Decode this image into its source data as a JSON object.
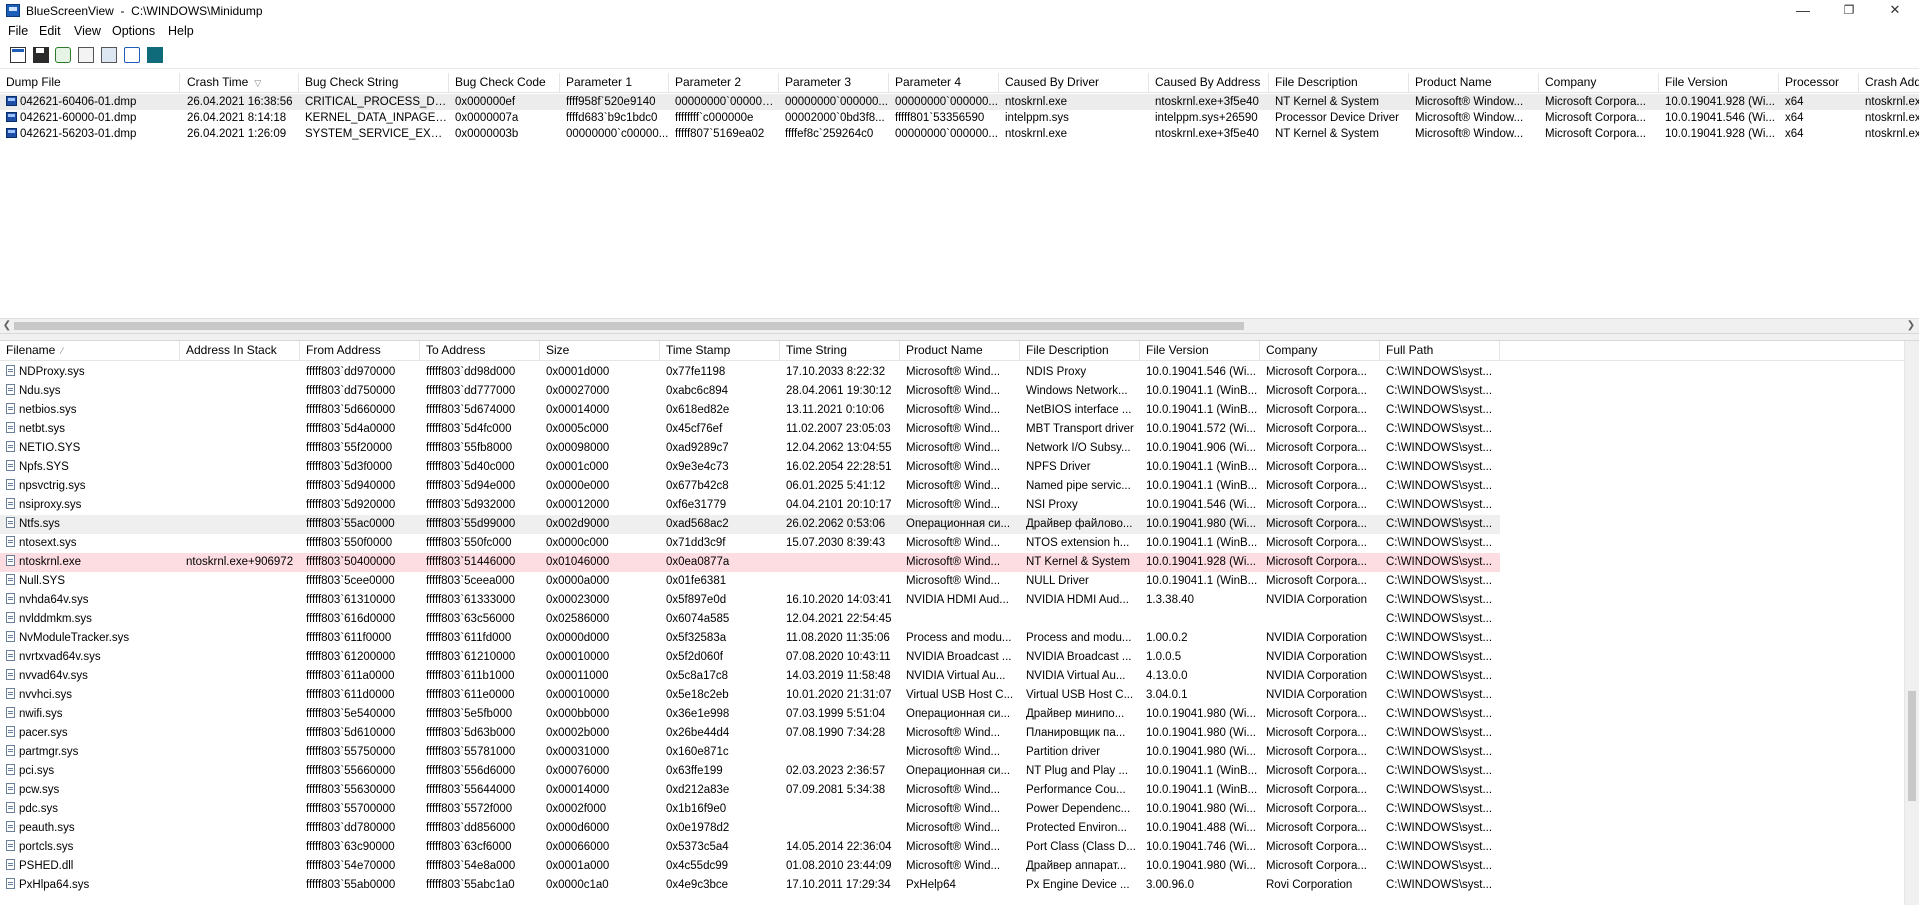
{
  "window": {
    "title": "BlueScreenView  -  C:\\WINDOWS\\Minidump",
    "minimize": "—",
    "maximize": "❐",
    "close": "✕"
  },
  "menu": [
    "File",
    "Edit",
    "View",
    "Options",
    "Help"
  ],
  "toolbar": [
    "properties-icon",
    "save-icon",
    "refresh-icon",
    "copy-icon",
    "html-report-icon",
    "find-icon",
    "exit-icon"
  ],
  "dumps": {
    "columns": [
      "Dump File",
      "Crash Time",
      "Bug Check String",
      "Bug Check Code",
      "Parameter 1",
      "Parameter 2",
      "Parameter 3",
      "Parameter 4",
      "Caused By Driver",
      "Caused By Address",
      "File Description",
      "Product Name",
      "Company",
      "File Version",
      "Processor",
      "Crash Address"
    ],
    "sort_indicator": "▽",
    "rows": [
      [
        "042621-60406-01.dmp",
        "26.04.2021 16:38:56",
        "CRITICAL_PROCESS_DIED",
        "0x000000ef",
        "ffff958f`520e9140",
        "00000000`0000000...",
        "00000000`000000...",
        "00000000`000000...",
        "ntoskrnl.exe",
        "ntoskrnl.exe+3f5e40",
        "NT Kernel & System",
        "Microsoft® Window...",
        "Microsoft Corpora...",
        "10.0.19041.928 (Wi...",
        "x64",
        "ntoskrnl.exe"
      ],
      [
        "042621-60000-01.dmp",
        "26.04.2021 8:14:18",
        "KERNEL_DATA_INPAGE_...",
        "0x0000007a",
        "ffffd683`b9c1bdc0",
        "ffffffff`c000000e",
        "00002000`0bd3f8...",
        "fffff801`53356590",
        "intelppm.sys",
        "intelppm.sys+26590",
        "Processor Device Driver",
        "Microsoft® Window...",
        "Microsoft Corpora...",
        "10.0.19041.546 (Wi...",
        "x64",
        "ntoskrnl.exe"
      ],
      [
        "042621-56203-01.dmp",
        "26.04.2021 1:26:09",
        "SYSTEM_SERVICE_EXCEP...",
        "0x0000003b",
        "00000000`c00000...",
        "fffff807`5169ea02",
        "ffffef8c`259264c0",
        "00000000`000000...",
        "ntoskrnl.exe",
        "ntoskrnl.exe+3f5e40",
        "NT Kernel & System",
        "Microsoft® Window...",
        "Microsoft Corpora...",
        "10.0.19041.928 (Wi...",
        "x64",
        "ntoskrnl.exe"
      ]
    ]
  },
  "modules": {
    "columns": [
      "Filename",
      "Address In Stack",
      "From Address",
      "To Address",
      "Size",
      "Time Stamp",
      "Time String",
      "Product Name",
      "File Description",
      "File Version",
      "Company",
      "Full Path"
    ],
    "sort_indicator": "⁄",
    "rows": [
      [
        "NDProxy.sys",
        "",
        "fffff803`dd970000",
        "fffff803`dd98d000",
        "0x0001d000",
        "0x77fe1198",
        "17.10.2033 8:22:32",
        "Microsoft® Wind...",
        "NDIS Proxy",
        "10.0.19041.546 (Wi...",
        "Microsoft Corpora...",
        "C:\\WINDOWS\\syst..."
      ],
      [
        "Ndu.sys",
        "",
        "fffff803`dd750000",
        "fffff803`dd777000",
        "0x00027000",
        "0xabc6c894",
        "28.04.2061 19:30:12",
        "Microsoft® Wind...",
        "Windows Network...",
        "10.0.19041.1 (WinB...",
        "Microsoft Corpora...",
        "C:\\WINDOWS\\syst..."
      ],
      [
        "netbios.sys",
        "",
        "fffff803`5d660000",
        "fffff803`5d674000",
        "0x00014000",
        "0x618ed82e",
        "13.11.2021 0:10:06",
        "Microsoft® Wind...",
        "NetBIOS interface ...",
        "10.0.19041.1 (WinB...",
        "Microsoft Corpora...",
        "C:\\WINDOWS\\syst..."
      ],
      [
        "netbt.sys",
        "",
        "fffff803`5d4a0000",
        "fffff803`5d4fc000",
        "0x0005c000",
        "0x45cf76ef",
        "11.02.2007 23:05:03",
        "Microsoft® Wind...",
        "MBT Transport driver",
        "10.0.19041.572 (Wi...",
        "Microsoft Corpora...",
        "C:\\WINDOWS\\syst..."
      ],
      [
        "NETIO.SYS",
        "",
        "fffff803`55f20000",
        "fffff803`55fb8000",
        "0x00098000",
        "0xad9289c7",
        "12.04.2062 13:04:55",
        "Microsoft® Wind...",
        "Network I/O Subsy...",
        "10.0.19041.906 (Wi...",
        "Microsoft Corpora...",
        "C:\\WINDOWS\\syst..."
      ],
      [
        "Npfs.SYS",
        "",
        "fffff803`5d3f0000",
        "fffff803`5d40c000",
        "0x0001c000",
        "0x9e3e4c73",
        "16.02.2054 22:28:51",
        "Microsoft® Wind...",
        "NPFS Driver",
        "10.0.19041.1 (WinB...",
        "Microsoft Corpora...",
        "C:\\WINDOWS\\syst..."
      ],
      [
        "npsvctrig.sys",
        "",
        "fffff803`5d940000",
        "fffff803`5d94e000",
        "0x0000e000",
        "0x677b42c8",
        "06.01.2025 5:41:12",
        "Microsoft® Wind...",
        "Named pipe servic...",
        "10.0.19041.1 (WinB...",
        "Microsoft Corpora...",
        "C:\\WINDOWS\\syst..."
      ],
      [
        "nsiproxy.sys",
        "",
        "fffff803`5d920000",
        "fffff803`5d932000",
        "0x00012000",
        "0xf6e31779",
        "04.04.2101 20:10:17",
        "Microsoft® Wind...",
        "NSI Proxy",
        "10.0.19041.546 (Wi...",
        "Microsoft Corpora...",
        "C:\\WINDOWS\\syst..."
      ],
      [
        "Ntfs.sys",
        "",
        "fffff803`55ac0000",
        "fffff803`55d99000",
        "0x002d9000",
        "0xad568ac2",
        "26.02.2062 0:53:06",
        "Операционная си...",
        "Драйвер файлово...",
        "10.0.19041.980 (Wi...",
        "Microsoft Corpora...",
        "C:\\WINDOWS\\syst..."
      ],
      [
        "ntosext.sys",
        "",
        "fffff803`550f0000",
        "fffff803`550fc000",
        "0x0000c000",
        "0x71dd3c9f",
        "15.07.2030 8:39:43",
        "Microsoft® Wind...",
        "NTOS extension h...",
        "10.0.19041.1 (WinB...",
        "Microsoft Corpora...",
        "C:\\WINDOWS\\syst..."
      ],
      [
        "ntoskrnl.exe",
        "ntoskrnl.exe+906972",
        "fffff803`50400000",
        "fffff803`51446000",
        "0x01046000",
        "0x0ea0877a",
        "",
        "Microsoft® Wind...",
        "NT Kernel & System",
        "10.0.19041.928 (Wi...",
        "Microsoft Corpora...",
        "C:\\WINDOWS\\syst..."
      ],
      [
        "Null.SYS",
        "",
        "fffff803`5cee0000",
        "fffff803`5ceea000",
        "0x0000a000",
        "0x01fe6381",
        "",
        "Microsoft® Wind...",
        "NULL Driver",
        "10.0.19041.1 (WinB...",
        "Microsoft Corpora...",
        "C:\\WINDOWS\\syst..."
      ],
      [
        "nvhda64v.sys",
        "",
        "fffff803`61310000",
        "fffff803`61333000",
        "0x00023000",
        "0x5f897e0d",
        "16.10.2020 14:03:41",
        "NVIDIA HDMI Aud...",
        "NVIDIA HDMI Aud...",
        "1.3.38.40",
        "NVIDIA Corporation",
        "C:\\WINDOWS\\syst..."
      ],
      [
        "nvlddmkm.sys",
        "",
        "fffff803`616d0000",
        "fffff803`63c56000",
        "0x02586000",
        "0x6074a585",
        "12.04.2021 22:54:45",
        "",
        "",
        "",
        "",
        "C:\\WINDOWS\\syst..."
      ],
      [
        "NvModuleTracker.sys",
        "",
        "fffff803`611f0000",
        "fffff803`611fd000",
        "0x0000d000",
        "0x5f32583a",
        "11.08.2020 11:35:06",
        "Process and modu...",
        "Process and modu...",
        "1.00.0.2",
        "NVIDIA Corporation",
        "C:\\WINDOWS\\syst..."
      ],
      [
        "nvrtxvad64v.sys",
        "",
        "fffff803`61200000",
        "fffff803`61210000",
        "0x00010000",
        "0x5f2d060f",
        "07.08.2020 10:43:11",
        "NVIDIA Broadcast ...",
        "NVIDIA Broadcast ...",
        "1.0.0.5",
        "NVIDIA Corporation",
        "C:\\WINDOWS\\syst..."
      ],
      [
        "nvvad64v.sys",
        "",
        "fffff803`611a0000",
        "fffff803`611b1000",
        "0x00011000",
        "0x5c8a17c8",
        "14.03.2019 11:58:48",
        "NVIDIA Virtual Au...",
        "NVIDIA Virtual Au...",
        "4.13.0.0",
        "NVIDIA Corporation",
        "C:\\WINDOWS\\syst..."
      ],
      [
        "nvvhci.sys",
        "",
        "fffff803`611d0000",
        "fffff803`611e0000",
        "0x00010000",
        "0x5e18c2eb",
        "10.01.2020 21:31:07",
        "Virtual USB Host C...",
        "Virtual USB Host C...",
        "3.04.0.1",
        "NVIDIA Corporation",
        "C:\\WINDOWS\\syst..."
      ],
      [
        "nwifi.sys",
        "",
        "fffff803`5e540000",
        "fffff803`5e5fb000",
        "0x000bb000",
        "0x36e1e998",
        "07.03.1999 5:51:04",
        "Операционная си...",
        "Драйвер минипо...",
        "10.0.19041.980 (Wi...",
        "Microsoft Corpora...",
        "C:\\WINDOWS\\syst..."
      ],
      [
        "pacer.sys",
        "",
        "fffff803`5d610000",
        "fffff803`5d63b000",
        "0x0002b000",
        "0x26be44d4",
        "07.08.1990 7:34:28",
        "Microsoft® Wind...",
        "Планировщик па...",
        "10.0.19041.980 (Wi...",
        "Microsoft Corpora...",
        "C:\\WINDOWS\\syst..."
      ],
      [
        "partmgr.sys",
        "",
        "fffff803`55750000",
        "fffff803`55781000",
        "0x00031000",
        "0x160e871c",
        "",
        "Microsoft® Wind...",
        "Partition driver",
        "10.0.19041.980 (Wi...",
        "Microsoft Corpora...",
        "C:\\WINDOWS\\syst..."
      ],
      [
        "pci.sys",
        "",
        "fffff803`55660000",
        "fffff803`556d6000",
        "0x00076000",
        "0x63ffe199",
        "02.03.2023 2:36:57",
        "Операционная си...",
        "NT Plug and Play ...",
        "10.0.19041.1 (WinB...",
        "Microsoft Corpora...",
        "C:\\WINDOWS\\syst..."
      ],
      [
        "pcw.sys",
        "",
        "fffff803`55630000",
        "fffff803`55644000",
        "0x00014000",
        "0xd212a83e",
        "07.09.2081 5:34:38",
        "Microsoft® Wind...",
        "Performance Cou...",
        "10.0.19041.1 (WinB...",
        "Microsoft Corpora...",
        "C:\\WINDOWS\\syst..."
      ],
      [
        "pdc.sys",
        "",
        "fffff803`55700000",
        "fffff803`5572f000",
        "0x0002f000",
        "0x1b16f9e0",
        "",
        "Microsoft® Wind...",
        "Power Dependenc...",
        "10.0.19041.980 (Wi...",
        "Microsoft Corpora...",
        "C:\\WINDOWS\\syst..."
      ],
      [
        "peauth.sys",
        "",
        "fffff803`dd780000",
        "fffff803`dd856000",
        "0x000d6000",
        "0x0e1978d2",
        "",
        "Microsoft® Wind...",
        "Protected Environ...",
        "10.0.19041.488 (Wi...",
        "Microsoft Corpora...",
        "C:\\WINDOWS\\syst..."
      ],
      [
        "portcls.sys",
        "",
        "fffff803`63c90000",
        "fffff803`63cf6000",
        "0x00066000",
        "0x5373c5a4",
        "14.05.2014 22:36:04",
        "Microsoft® Wind...",
        "Port Class (Class D...",
        "10.0.19041.746 (Wi...",
        "Microsoft Corpora...",
        "C:\\WINDOWS\\syst..."
      ],
      [
        "PSHED.dll",
        "",
        "fffff803`54e70000",
        "fffff803`54e8a000",
        "0x0001a000",
        "0x4c55dc99",
        "01.08.2010 23:44:09",
        "Microsoft® Wind...",
        "Драйвер аппарат...",
        "10.0.19041.980 (Wi...",
        "Microsoft Corpora...",
        "C:\\WINDOWS\\syst..."
      ],
      [
        "PxHlpa64.sys",
        "",
        "fffff803`55ab0000",
        "fffff803`55abc1a0",
        "0x0000c1a0",
        "0x4e9c3bce",
        "17.10.2011 17:29:34",
        "PxHelp64",
        "Px Engine Device ...",
        "3.00.96.0",
        "Rovi Corporation",
        "C:\\WINDOWS\\syst..."
      ]
    ]
  }
}
